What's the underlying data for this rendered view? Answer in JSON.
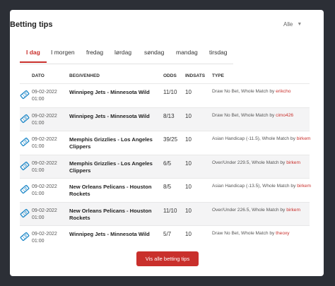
{
  "card": {
    "title": "Betting tips",
    "filter_value": "Alle"
  },
  "tabs": [
    {
      "label": "I dag",
      "active": true
    },
    {
      "label": "I morgen"
    },
    {
      "label": "fredag"
    },
    {
      "label": "lørdag"
    },
    {
      "label": "søndag"
    },
    {
      "label": "mandag"
    },
    {
      "label": "tirsdag"
    }
  ],
  "table": {
    "headers": {
      "date": "DATO",
      "event": "BEGIVENHED",
      "odds": "ODDS",
      "stake": "INDSATS",
      "type": "TYPE"
    },
    "rows": [
      {
        "date_line1": "09-02-2022",
        "date_line2": "01:00",
        "event": "Winnipeg Jets - Minnesota Wild",
        "odds": "11/10",
        "stake": "10",
        "type_text": "Draw No Bet, Whole Match by ",
        "author": "erikcho"
      },
      {
        "date_line1": "09-02-2022",
        "date_line2": "01:00",
        "event": "Winnipeg Jets - Minnesota Wild",
        "odds": "8/13",
        "stake": "10",
        "type_text": "Draw No Bet, Whole Match by ",
        "author": "cimo426"
      },
      {
        "date_line1": "09-02-2022",
        "date_line2": "01:00",
        "event": "Memphis Grizzlies - Los Angeles Clippers",
        "odds": "39/25",
        "stake": "10",
        "type_text": "Asian Handicap (-11.5), Whole Match by ",
        "author": "birkem"
      },
      {
        "date_line1": "09-02-2022",
        "date_line2": "01:00",
        "event": "Memphis Grizzlies - Los Angeles Clippers",
        "odds": "6/5",
        "stake": "10",
        "type_text": "Over/Under 229.5, Whole Match by ",
        "author": "birkem"
      },
      {
        "date_line1": "09-02-2022",
        "date_line2": "01:00",
        "event": "New Orleans Pelicans - Houston Rockets",
        "odds": "8/5",
        "stake": "10",
        "type_text": "Asian Handicap (-13.5), Whole Match by ",
        "author": "birkem"
      },
      {
        "date_line1": "09-02-2022",
        "date_line2": "01:00",
        "event": "New Orleans Pelicans - Houston Rockets",
        "odds": "11/10",
        "stake": "10",
        "type_text": "Over/Under 226.5, Whole Match by ",
        "author": "birkem"
      },
      {
        "date_line1": "09-02-2022",
        "date_line2": "01:00",
        "event": "Winnipeg Jets - Minnesota Wild",
        "odds": "5/7",
        "stake": "10",
        "type_text": "Draw No Bet, Whole Match by ",
        "author": "theoxy"
      }
    ]
  },
  "button": {
    "label": "Vis alle betting tips"
  },
  "colors": {
    "accent": "#c9302c",
    "icon": "#1e88c8",
    "background": "#2c2f36"
  },
  "icons": {
    "row_icon": "ticket-icon",
    "filter_icon": "caret-down-icon"
  }
}
